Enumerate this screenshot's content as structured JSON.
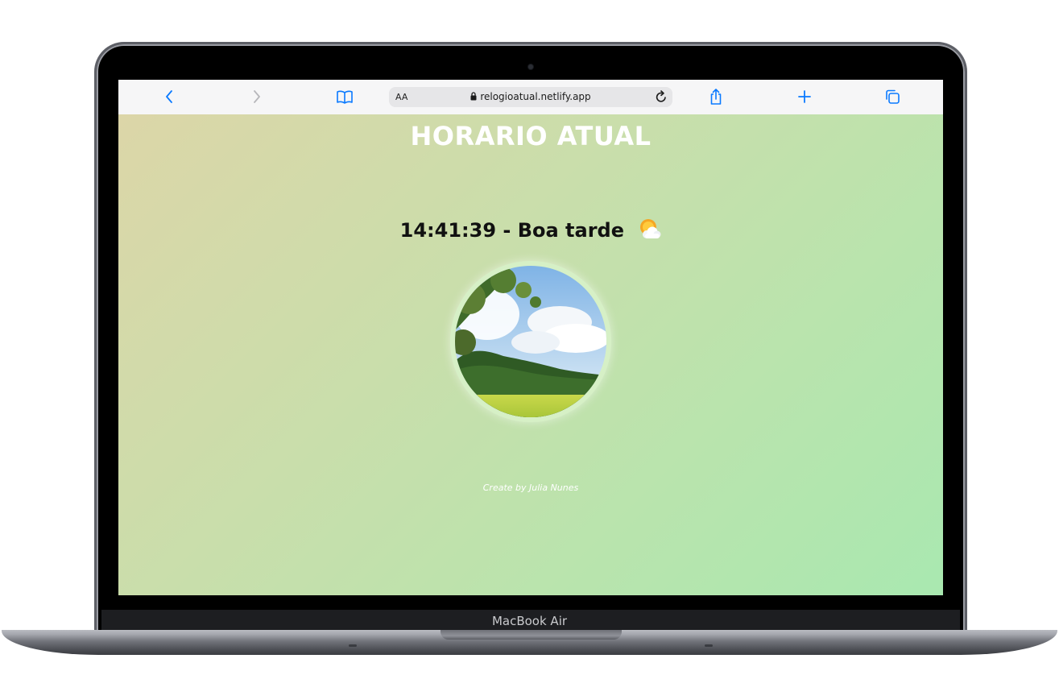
{
  "device": {
    "label": "MacBook Air"
  },
  "browser": {
    "text_size_label": "AA",
    "url": "relogioatual.netlify.app",
    "icons": [
      "back-icon",
      "forward-icon",
      "bookmarks-icon",
      "lock-icon",
      "reload-icon",
      "share-icon",
      "new-tab-icon",
      "tabs-icon"
    ],
    "accent_color": "#0a7aff"
  },
  "page": {
    "title": "HORARIO ATUAL",
    "clock": "14:41:39 - Boa tarde",
    "weather_icon": "sun-behind-cloud-icon",
    "credit": "Create by Julia Nunes",
    "gradient": [
      "#dcd6a8",
      "#a9e8b0"
    ]
  }
}
